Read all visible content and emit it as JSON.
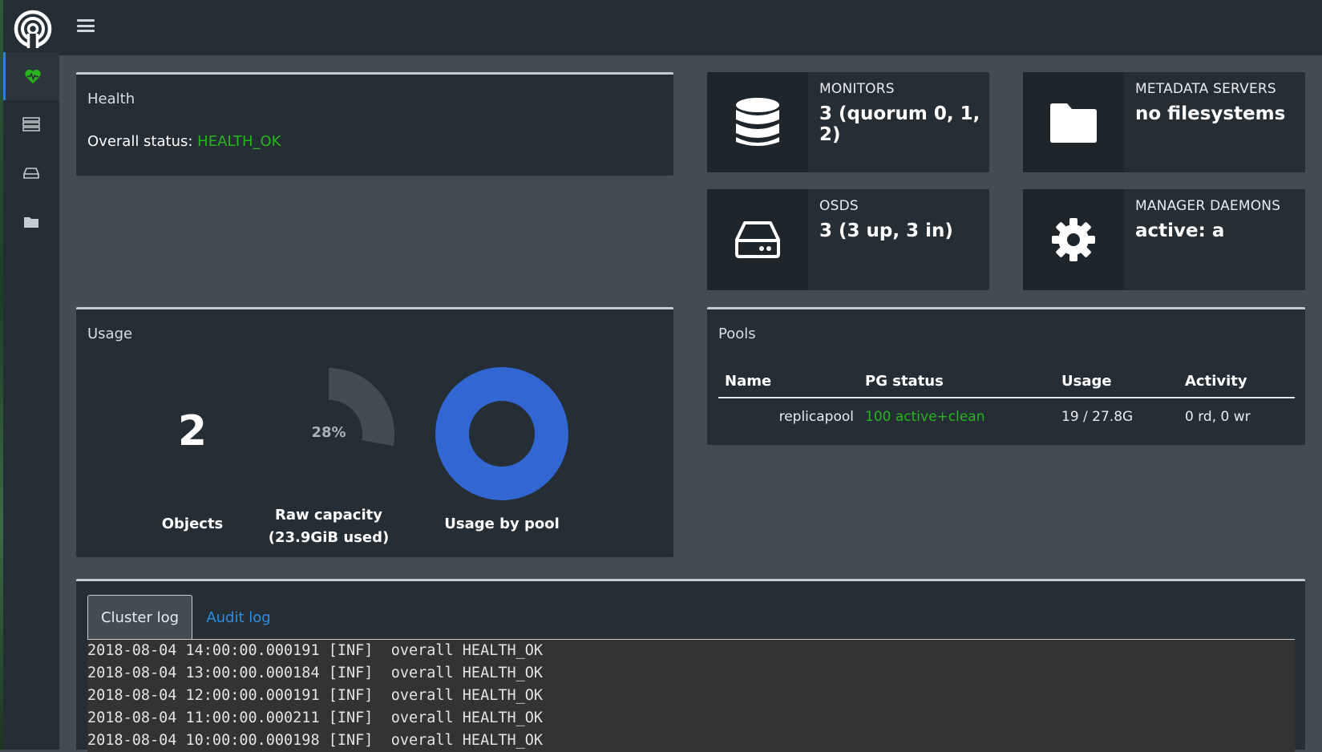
{
  "header": {
    "menu_icon": "hamburger-icon",
    "logo_icon": "ceph-logo-icon"
  },
  "sidebar": {
    "items": [
      {
        "icon": "heartbeat-icon",
        "active": true
      },
      {
        "icon": "server-icon",
        "active": false
      },
      {
        "icon": "hdd-icon",
        "active": false
      },
      {
        "icon": "folder-icon",
        "active": false
      }
    ]
  },
  "health": {
    "title": "Health",
    "status_label": "Overall status:",
    "status_value": "HEALTH_OK",
    "ok_color": "#28b41e"
  },
  "stats": {
    "monitors": {
      "label": "MONITORS",
      "value": "3 (quorum 0, 1, 2)",
      "icon": "database-icon"
    },
    "metadata": {
      "label": "METADATA SERVERS",
      "value": "no filesystems",
      "icon": "folder-icon"
    },
    "osds": {
      "label": "OSDS",
      "value": "3 (3 up, 3 in)",
      "icon": "hdd-icon"
    },
    "managers": {
      "label": "MANAGER DAEMONS",
      "value": "active: a",
      "icon": "gear-icon"
    }
  },
  "usage": {
    "title": "Usage",
    "objects_value": "2",
    "objects_label": "Objects",
    "raw_capacity_percent_label": "28%",
    "raw_capacity_fraction": 0.28,
    "raw_capacity_label_line1": "Raw capacity",
    "raw_capacity_label_line2": "(23.9GiB used)",
    "usage_by_pool_label": "Usage by pool",
    "pool_color": "#3166d3"
  },
  "pools": {
    "title": "Pools",
    "columns": [
      "Name",
      "PG status",
      "Usage",
      "Activity"
    ],
    "rows": [
      {
        "name": "replicapool",
        "pg_status": "100 active+clean",
        "usage": "19 / 27.8G",
        "activity": "0 rd, 0 wr"
      }
    ]
  },
  "logs": {
    "tabs": [
      {
        "label": "Cluster log",
        "active": true
      },
      {
        "label": "Audit log",
        "active": false
      }
    ],
    "lines": [
      "2018-08-04 14:00:00.000191 [INF]  overall HEALTH_OK",
      "2018-08-04 13:00:00.000184 [INF]  overall HEALTH_OK",
      "2018-08-04 12:00:00.000191 [INF]  overall HEALTH_OK",
      "2018-08-04 11:00:00.000211 [INF]  overall HEALTH_OK",
      "2018-08-04 10:00:00.000198 [INF]  overall HEALTH_OK"
    ]
  }
}
